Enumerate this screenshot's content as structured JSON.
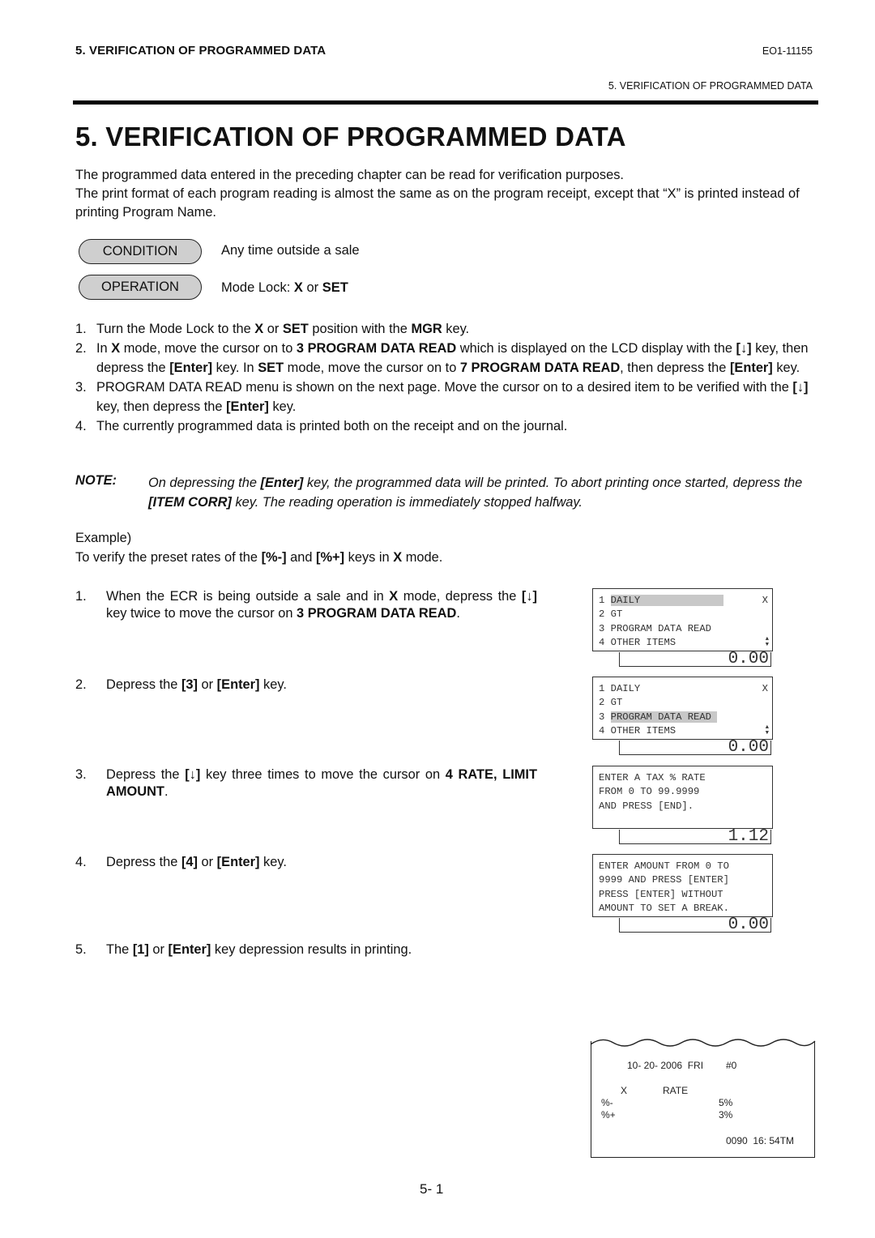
{
  "header": {
    "section_title": "5. VERIFICATION OF PROGRAMMED DATA",
    "doc_code": "EO1-11155",
    "running_head": "5. VERIFICATION OF PROGRAMMED DATA"
  },
  "title": "5.  VERIFICATION OF PROGRAMMED DATA",
  "intro": [
    "The programmed data entered in the preceding chapter can be read for verification purposes.",
    "The print format of each program reading is almost the same as on the program receipt, except that “X” is printed instead of printing Program Name."
  ],
  "condition": {
    "label": "CONDITION",
    "text": "Any time outside a sale"
  },
  "operation": {
    "label": "OPERATION",
    "text_prefix": "Mode Lock: ",
    "x": "X",
    "or": " or ",
    "set": "SET"
  },
  "steps": [
    {
      "num": "1.",
      "parts": [
        "Turn the Mode Lock to the ",
        "*X",
        " or ",
        "*SET",
        " position with the ",
        "*MGR",
        " key."
      ]
    },
    {
      "num": "2.",
      "parts": [
        "In ",
        "*X",
        " mode, move the cursor on to ",
        "*3 PROGRAM DATA READ",
        " which is displayed on the LCD display with the ",
        "*[↓]",
        " key, then depress the ",
        "*[Enter]",
        " key.  In ",
        "*SET",
        " mode, move the cursor on to ",
        "*7 PROGRAM DATA READ",
        ", then depress the ",
        "*[Enter]",
        " key."
      ]
    },
    {
      "num": "3.",
      "parts": [
        "PROGRAM DATA READ menu is shown on the next page.  Move the cursor on to a desired item to be verified with the ",
        "*[↓]",
        " key, then depress the ",
        "*[Enter]",
        " key."
      ]
    },
    {
      "num": "4.",
      "parts": [
        "The currently programmed data is printed both on the receipt and on the journal."
      ]
    }
  ],
  "note": {
    "label": "NOTE:",
    "parts": [
      "On depressing the ",
      "*[Enter]",
      " key, the programmed data will be printed.  To abort printing once started, depress the ",
      "*[ITEM CORR]",
      " key.  The reading operation is immediately stopped halfway."
    ]
  },
  "example": {
    "label": "Example)",
    "parts": [
      "To verify the preset rates of the ",
      "*[%-]",
      " and ",
      "*[%+]",
      " keys in ",
      "*X",
      " mode."
    ],
    "steps": [
      {
        "num": "1.",
        "parts": [
          "When the ECR is being outside a sale and in ",
          "*X",
          " mode, depress the ",
          "*[↓]",
          " key twice to move the cursor on ",
          "*3 PROGRAM DATA READ",
          "."
        ]
      },
      {
        "num": "2.",
        "parts": [
          "Depress the ",
          "*[3]",
          " or ",
          "*[Enter]",
          " key."
        ]
      },
      {
        "num": "3.",
        "parts": [
          "Depress the ",
          "*[↓]",
          " key three times to move the cursor on ",
          "*4 RATE, LIMIT AMOUNT",
          "."
        ]
      },
      {
        "num": "4.",
        "parts": [
          "Depress the ",
          "*[4]",
          " or ",
          "*[Enter]",
          " key."
        ]
      },
      {
        "num": "5.",
        "parts": [
          "The ",
          "*[1]",
          " or ",
          "*[Enter]",
          " key depression results in printing."
        ]
      }
    ]
  },
  "lcd_screens": [
    {
      "rows": [
        "1 DAILY",
        "2 GT",
        "3 PROGRAM DATA READ",
        "4 OTHER ITEMS"
      ],
      "highlight_row": 0,
      "mode": "X",
      "show_arrows": true,
      "value": "0.00"
    },
    {
      "rows": [
        "1 DAILY",
        "2 GT",
        "3 PROGRAM DATA READ",
        "4 OTHER ITEMS"
      ],
      "highlight_row": 2,
      "mode": "X",
      "show_arrows": true,
      "value": "0.00"
    },
    {
      "rows": [
        "ENTER A TAX % RATE",
        "FROM 0 TO 99.9999",
        "AND PRESS [END]."
      ],
      "highlight_row": -1,
      "mode": "",
      "show_arrows": false,
      "value": "1.12"
    },
    {
      "rows": [
        "ENTER AMOUNT FROM 0 TO",
        "9999 AND PRESS [ENTER]",
        "PRESS [ENTER] WITHOUT",
        "AMOUNT TO SET A BREAK."
      ],
      "highlight_row": -1,
      "mode": "",
      "show_arrows": false,
      "value": "0.00"
    }
  ],
  "receipt": {
    "date_line": "10- 20- 2006  FRI",
    "register": "#0",
    "mode": "X",
    "heading": "RATE",
    "lines": [
      {
        "key": "%-",
        "value": "5%"
      },
      {
        "key": "%+",
        "value": "3%"
      }
    ],
    "footer": "0090  16: 54TM"
  },
  "page_number": "5- 1"
}
